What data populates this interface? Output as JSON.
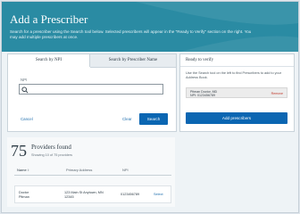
{
  "header": {
    "title": "Add a Prescriber",
    "subtitle": "Search for a prescriber using the Search tool below. Selected prescribers will appear in the \"Ready to Verify\" section on the right. You may add multiple prescribers at once."
  },
  "search": {
    "tabs": [
      {
        "label": "Search by NPI",
        "active": true
      },
      {
        "label": "Search by Prescriber Name",
        "active": false
      }
    ],
    "npi_label": "NPI",
    "npi_value": "",
    "cancel_label": "Cancel",
    "clear_label": "Clear",
    "search_label": "Search"
  },
  "ready": {
    "title": "Ready to verify",
    "description": "Use the Search tool on the left to find Prescribers to add to your Address Book.",
    "prescriber": {
      "name": "Pitman Doctor, MD",
      "npi": "NPI: 0123456789",
      "remove_label": "Remove"
    },
    "add_label": "Add prescribers"
  },
  "results": {
    "count": "75",
    "label": "Providers found",
    "sub": "Showing 10 of 75 providers",
    "columns": {
      "name": "Name ↕",
      "address": "Primary Address",
      "npi": "NPI"
    },
    "rows": [
      {
        "name": "Doctor Pitman",
        "address": "123 Main St Anytown, MN 12345",
        "npi": "0123456789",
        "action": "Select"
      }
    ]
  },
  "colors": {
    "header": "#2a8ba3",
    "primary_button": "#0b66b2",
    "link": "#1f6fae",
    "remove": "#c0392b"
  }
}
